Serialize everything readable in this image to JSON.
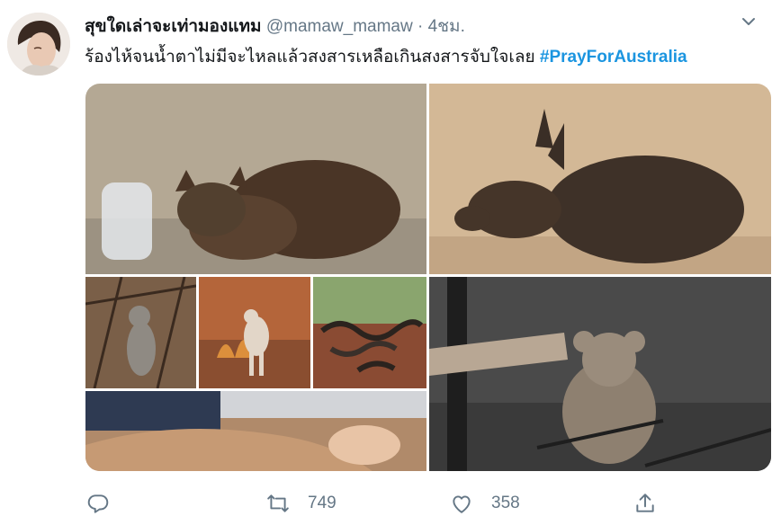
{
  "tweet": {
    "display_name": "สุขใดเล่าจะเท่ามองแทม",
    "handle": "@mamaw_mamaw",
    "separator": "·",
    "time": "4ชม.",
    "text": "ร้องไห้จนน้ำตาไม่มีจะไหลแล้วสงสารเหลือเกินสงสารจับใจเลย",
    "hashtag": "#PrayForAustralia"
  },
  "actions": {
    "reply_icon": "reply-icon",
    "retweet_icon": "retweet-icon",
    "retweet_count": "749",
    "like_icon": "heart-icon",
    "like_count": "358",
    "share_icon": "share-icon"
  },
  "colors": {
    "hashtag": "#1b95e0",
    "muted": "#657786",
    "name": "#14171a"
  }
}
